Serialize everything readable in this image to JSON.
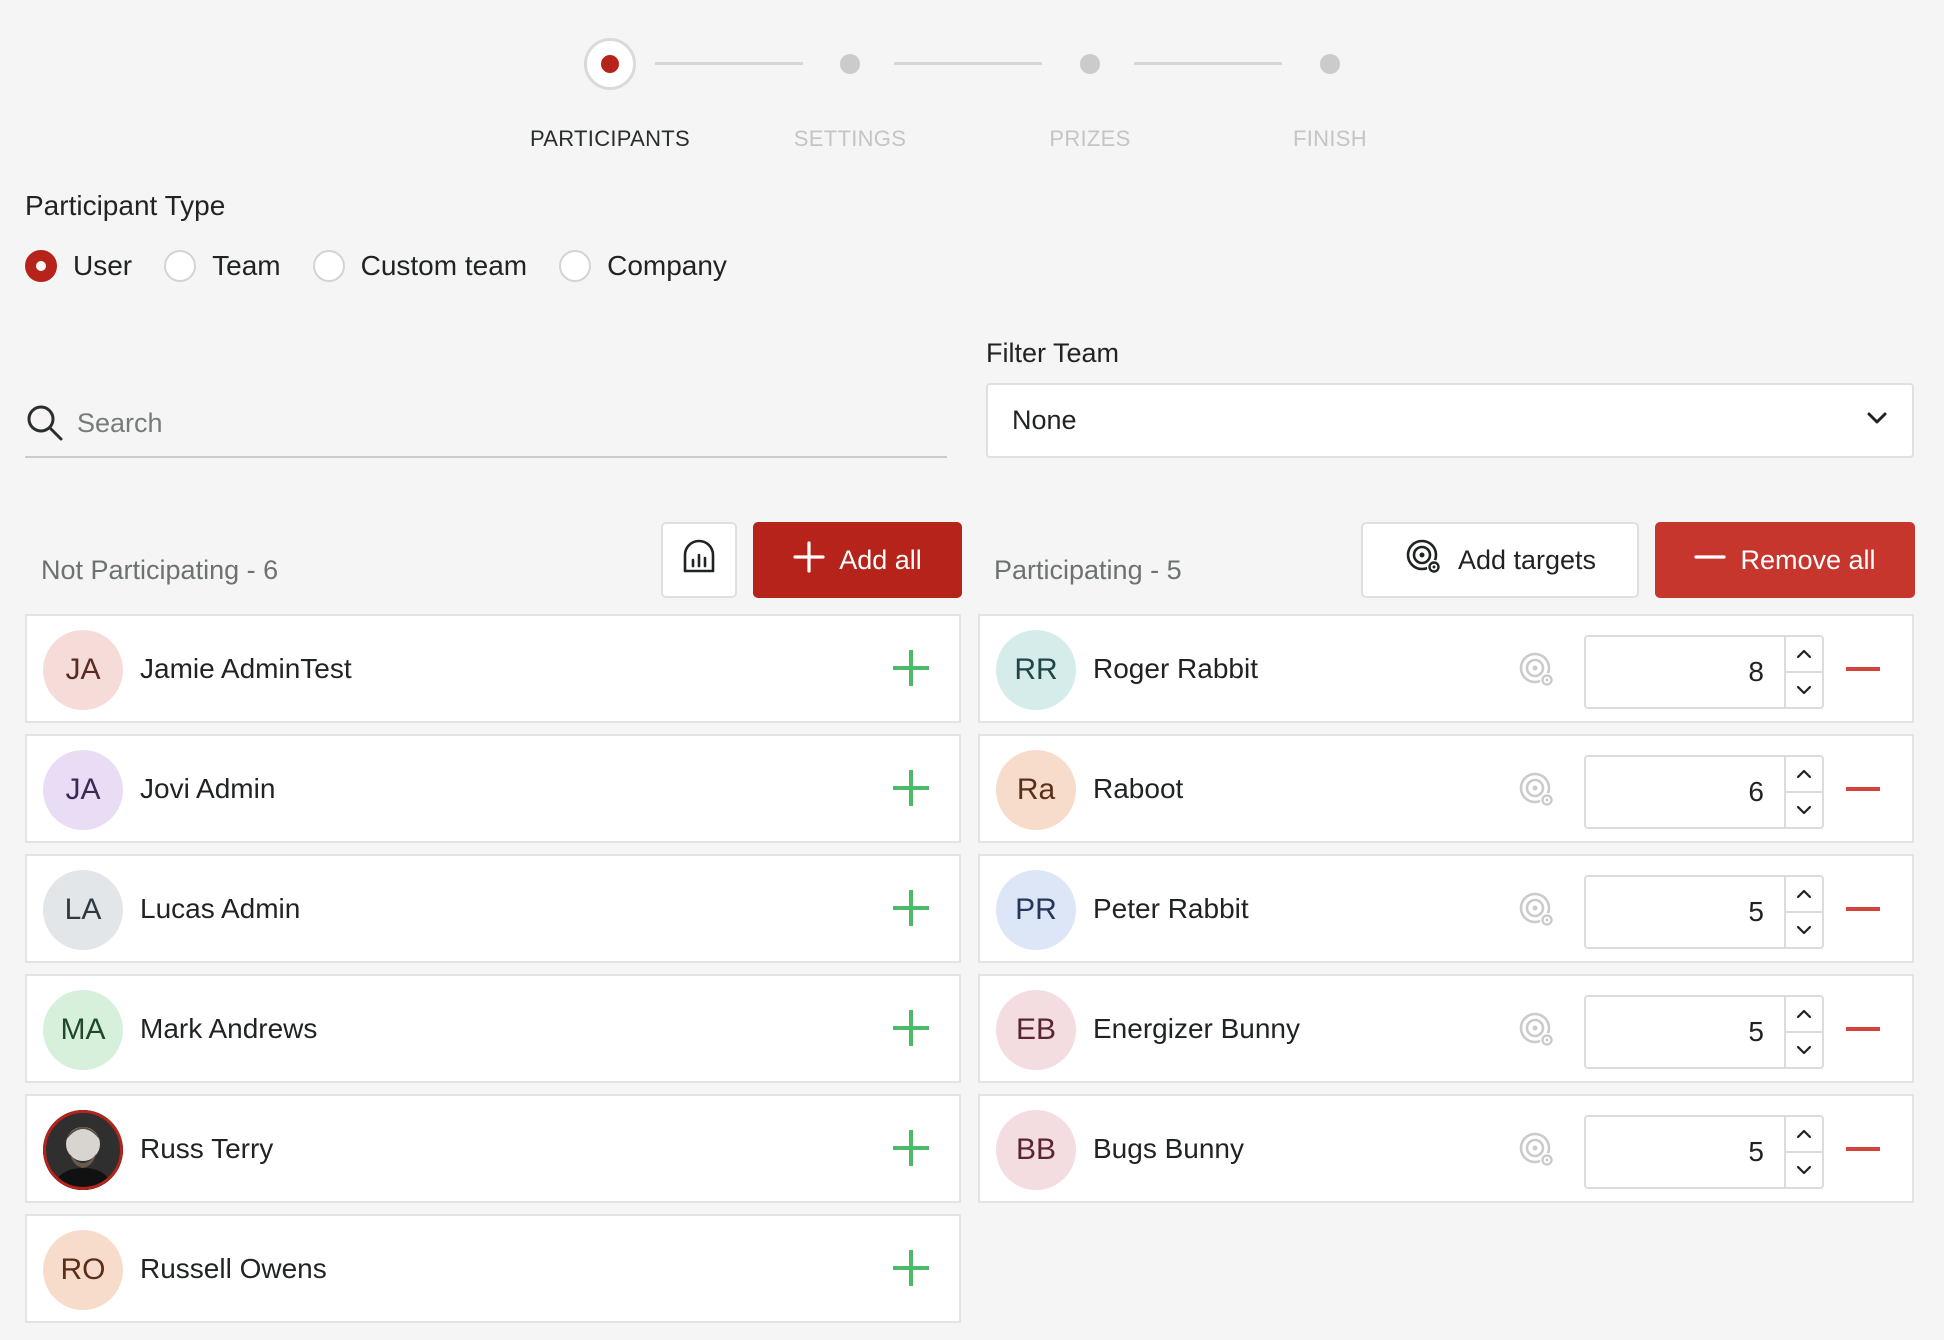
{
  "stepper": {
    "steps": [
      {
        "label": "PARTICIPANTS",
        "active": true
      },
      {
        "label": "SETTINGS",
        "active": false
      },
      {
        "label": "PRIZES",
        "active": false
      },
      {
        "label": "FINISH",
        "active": false
      }
    ]
  },
  "participant_type": {
    "title": "Participant Type",
    "options": [
      {
        "label": "User",
        "checked": true
      },
      {
        "label": "Team",
        "checked": false
      },
      {
        "label": "Custom team",
        "checked": false
      },
      {
        "label": "Company",
        "checked": false
      }
    ]
  },
  "search": {
    "placeholder": "Search",
    "value": ""
  },
  "filter": {
    "label": "Filter Team",
    "value": "None"
  },
  "not_participating": {
    "title": "Not Participating - 6",
    "add_all_label": "Add all",
    "items": [
      {
        "initials": "JA",
        "name": "Jamie AdminTest",
        "bg": "#f6dcd9",
        "fg": "#5a2a25"
      },
      {
        "initials": "JA",
        "name": "Jovi Admin",
        "bg": "#e9dcf5",
        "fg": "#3c2a55"
      },
      {
        "initials": "LA",
        "name": "Lucas Admin",
        "bg": "#e3e6e8",
        "fg": "#2f3a40"
      },
      {
        "initials": "MA",
        "name": "Mark Andrews",
        "bg": "#d7f0dc",
        "fg": "#1f4a2a"
      },
      {
        "initials": "",
        "name": "Russ Terry",
        "bg": "#3a3a3a",
        "fg": "#ffffff",
        "photo": true
      },
      {
        "initials": "RO",
        "name": "Russell Owens",
        "bg": "#f8dccb",
        "fg": "#5a2f1a"
      }
    ]
  },
  "participating": {
    "title": "Participating - 5",
    "add_targets_label": "Add targets",
    "remove_all_label": "Remove all",
    "items": [
      {
        "initials": "RR",
        "name": "Roger Rabbit",
        "target": "8",
        "bg": "#d5eceb",
        "fg": "#1f4645"
      },
      {
        "initials": "Ra",
        "name": "Raboot",
        "target": "6",
        "bg": "#f8dccb",
        "fg": "#5a2f1a"
      },
      {
        "initials": "PR",
        "name": "Peter Rabbit",
        "target": "5",
        "bg": "#dce6f6",
        "fg": "#24365a"
      },
      {
        "initials": "EB",
        "name": "Energizer Bunny",
        "target": "5",
        "bg": "#f3dde0",
        "fg": "#5a2430"
      },
      {
        "initials": "BB",
        "name": "Bugs Bunny",
        "target": "5",
        "bg": "#f3dde0",
        "fg": "#5a2430"
      }
    ]
  },
  "colors": {
    "accent": "#b5231b",
    "remove": "#c7362c",
    "add_plus": "#4cba6b"
  }
}
